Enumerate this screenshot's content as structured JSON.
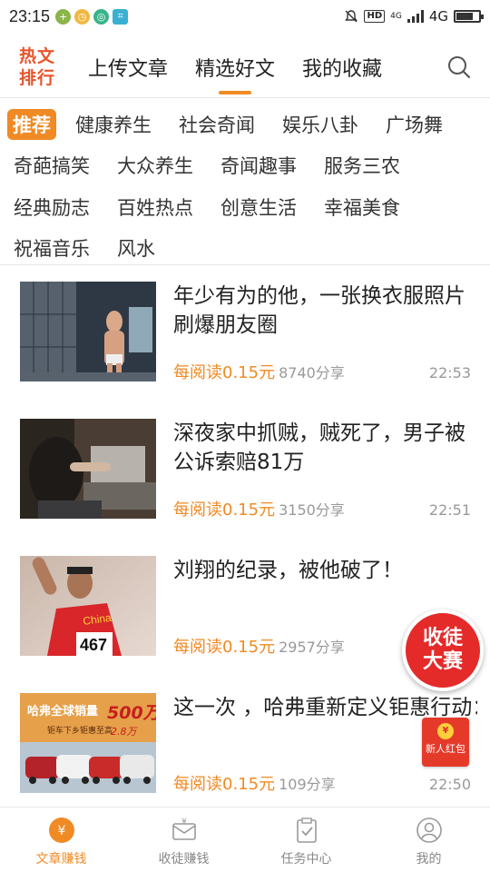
{
  "status_bar": {
    "time": "23:15",
    "network": "4G",
    "hd": "HD",
    "net_badge": "4G",
    "battery_level": 0.75
  },
  "header": {
    "hot_rank": [
      "热文",
      "排行"
    ],
    "tabs": [
      {
        "label": "上传文章",
        "active": false
      },
      {
        "label": "精选好文",
        "active": true
      },
      {
        "label": "我的收藏",
        "active": false
      }
    ],
    "search_icon": "search-icon"
  },
  "categories": [
    [
      "推荐",
      "健康养生",
      "社会奇闻",
      "娱乐八卦",
      "广场舞"
    ],
    [
      "奇葩搞笑",
      "大众养生",
      "奇闻趣事",
      "服务三农"
    ],
    [
      "经典励志",
      "百姓热点",
      "创意生活",
      "幸福美食"
    ],
    [
      "祝福音乐",
      "风水"
    ]
  ],
  "active_category": "推荐",
  "articles": [
    {
      "title": "年少有为的他，一张换衣服照片刷爆朋友圈",
      "reward": "每阅读0.15元",
      "shares": "8740分享",
      "time": "22:53"
    },
    {
      "title": "深夜家中抓贼，贼死了，男子被公诉索赔81万",
      "reward": "每阅读0.15元",
      "shares": "3150分享",
      "time": "22:51"
    },
    {
      "title": "刘翔的纪录，被他破了！",
      "reward": "每阅读0.15元",
      "shares": "2957分享",
      "time": ""
    },
    {
      "title": "这一次 ，哈弗重新定义钜惠行动：除了最高让利",
      "reward": "每阅读0.15元",
      "shares": "109分享",
      "time": "22:50"
    }
  ],
  "thumb_text": {
    "jersey_text": "China",
    "bib_number": "467",
    "ad_headline": "哈弗全球销量",
    "ad_number": "500万",
    "ad_subline": "钜车下乡钜惠至高",
    "ad_amount": "2.8万"
  },
  "float_contest": [
    "收徒",
    "大赛"
  ],
  "red_packet": {
    "label": "新人红包",
    "coin": "¥"
  },
  "bottom_nav": [
    {
      "label": "文章赚钱",
      "active": true,
      "icon": "yuan-coin-icon"
    },
    {
      "label": "收徒赚钱",
      "active": false,
      "icon": "envelope-icon"
    },
    {
      "label": "任务中心",
      "active": false,
      "icon": "clipboard-check-icon"
    },
    {
      "label": "我的",
      "active": false,
      "icon": "user-icon"
    }
  ],
  "colors": {
    "accent": "#f08a24",
    "hot": "#e8542b",
    "red": "#e52a2a"
  }
}
